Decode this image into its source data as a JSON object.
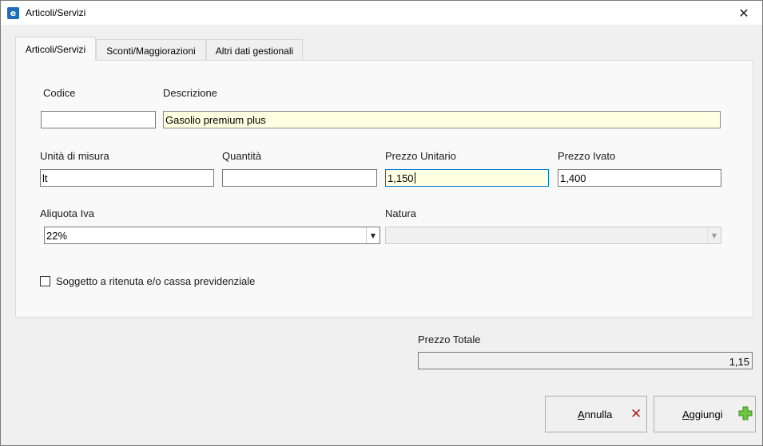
{
  "window": {
    "title": "Articoli/Servizi",
    "app_icon_glyph": "e",
    "close_glyph": "✕"
  },
  "tabs": [
    {
      "label": "Articoli/Servizi",
      "active": true
    },
    {
      "label": "Sconti/Maggiorazioni",
      "active": false
    },
    {
      "label": "Altri dati gestionali",
      "active": false
    }
  ],
  "form": {
    "codice": {
      "label": "Codice",
      "value": ""
    },
    "descrizione": {
      "label": "Descrizione",
      "value": "Gasolio premium plus"
    },
    "unita_misura": {
      "label": "Unità di misura",
      "value": "lt"
    },
    "quantita": {
      "label": "Quantità",
      "value": ""
    },
    "prezzo_unitario": {
      "label": "Prezzo Unitario",
      "value": "1,150"
    },
    "prezzo_ivato": {
      "label": "Prezzo Ivato",
      "value": "1,400"
    },
    "aliquota_iva": {
      "label": "Aliquota Iva",
      "value": "22%"
    },
    "natura": {
      "label": "Natura",
      "value": ""
    },
    "ritenuta": {
      "label": "Soggetto a ritenuta e/o cassa previdenziale",
      "checked": false
    }
  },
  "totale": {
    "label": "Prezzo Totale",
    "value": "1,15"
  },
  "buttons": {
    "annulla": {
      "label": "Annulla",
      "icon": "close-x-icon",
      "icon_color": "#b22222"
    },
    "aggiungi": {
      "label": "Aggiungi",
      "icon": "plus-icon",
      "icon_color": "#5cb82e"
    }
  },
  "colors": {
    "accent_focus": "#0078d7",
    "required_field_bg": "#ffffe1"
  }
}
